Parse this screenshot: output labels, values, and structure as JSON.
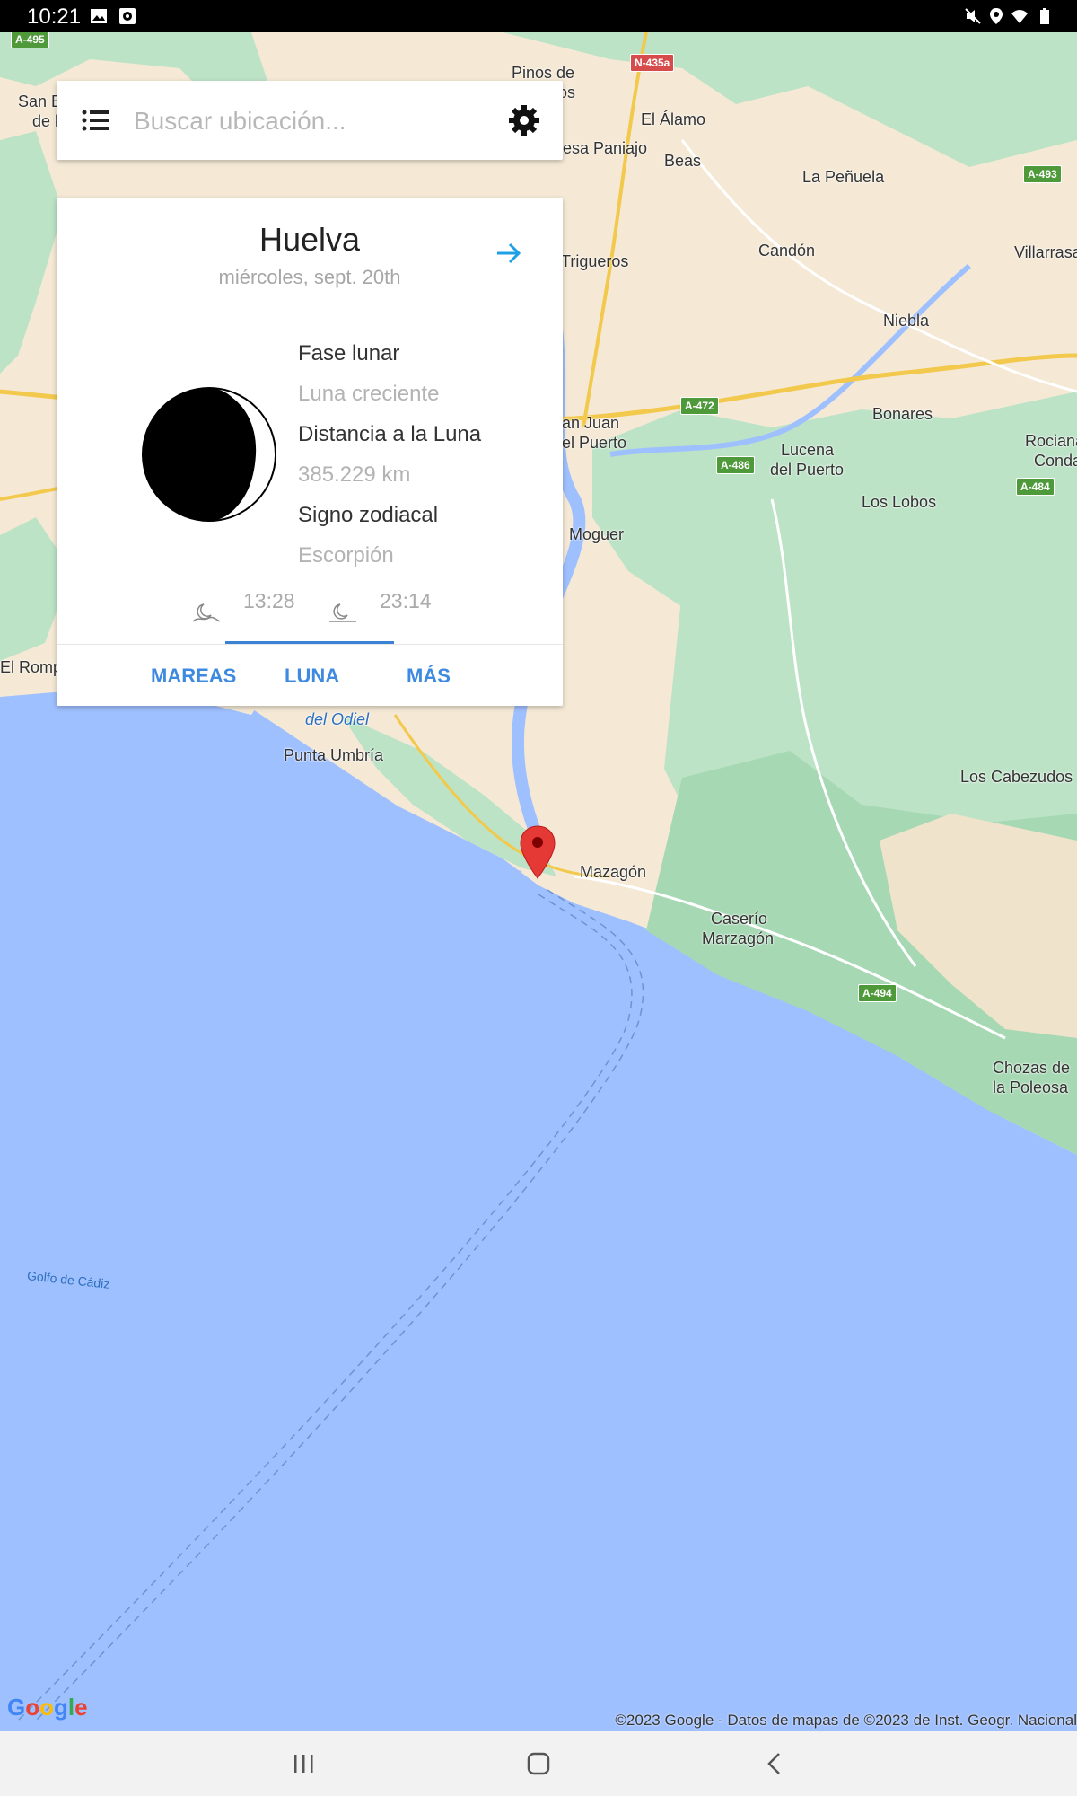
{
  "status_bar": {
    "time": "10:21"
  },
  "search": {
    "placeholder": "Buscar ubicación..."
  },
  "card": {
    "city": "Huelva",
    "date": "miércoles, sept. 20th",
    "phase_label": "Fase lunar",
    "phase_value": "Luna creciente",
    "distance_label": "Distancia a la Luna",
    "distance_value": "385.229 km",
    "zodiac_label": "Signo zodiacal",
    "zodiac_value": "Escorpión",
    "moonrise": "13:28",
    "moonset": "23:14",
    "tabs": [
      {
        "label": "MAREAS"
      },
      {
        "label": "LUNA",
        "selected": true
      },
      {
        "label": "MÁS"
      }
    ]
  },
  "map": {
    "places": [
      "Pinos de",
      "os",
      "El Álamo",
      "esa Paniajo",
      "Beas",
      "La Peñuela",
      "Candón",
      "Villarrasa",
      "Trigueros",
      "Niebla",
      "an Juan",
      "el Puerto",
      "Bonares",
      "Lucena",
      "del Puerto",
      "Rociana",
      "Conda",
      "Los Lobos",
      "Moguer",
      "El Rompi",
      "del Odiel",
      "Punta Umbría",
      "Los Cabezudos",
      "Mazagón",
      "Caserío",
      "Marzagón",
      "Chozas de",
      "la Poleosa",
      "San B",
      "de l",
      "Golfo de Cádiz"
    ],
    "roads": [
      "A-495",
      "N-435a",
      "A-493",
      "A-472",
      "A-486",
      "A-484",
      "A-494"
    ],
    "logo": "Google",
    "copyright": "©2023 Google - Datos de mapas de ©2023 de Inst. Geogr. Nacional"
  },
  "colors": {
    "accent": "#3d8ae0",
    "sea": "#9fc0ff",
    "land": "#f5e9d6",
    "park": "#bde3c7",
    "pin": "#e53935"
  }
}
